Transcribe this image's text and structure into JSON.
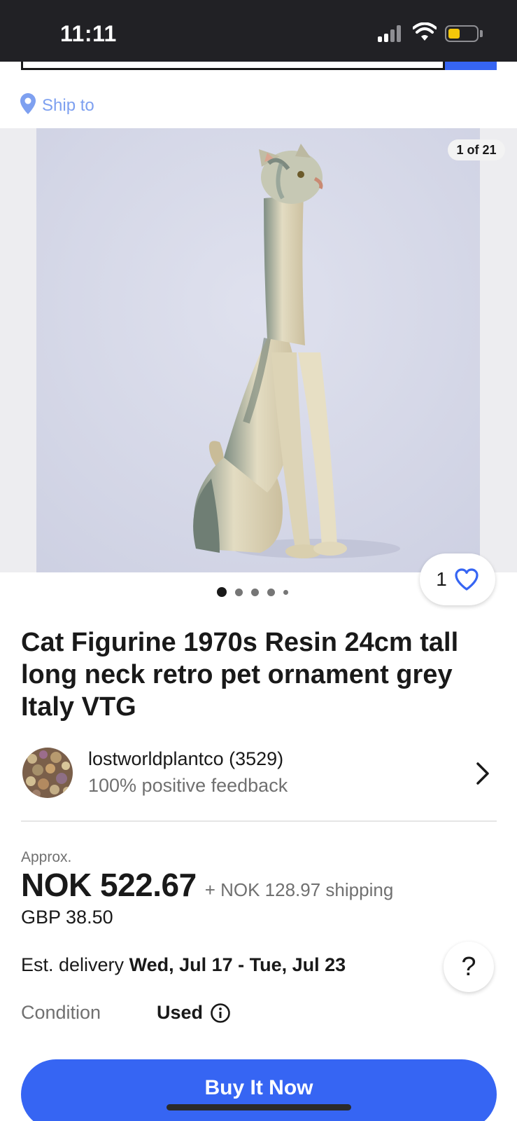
{
  "status_bar": {
    "time": "11:11"
  },
  "ship_to": {
    "label": "Ship to"
  },
  "gallery": {
    "counter": "1 of 21",
    "watch_count": "1",
    "dots_total": 5,
    "dots_active_index": 0
  },
  "listing": {
    "title": "Cat Figurine 1970s Resin 24cm tall long neck retro pet ornament grey Italy VTG"
  },
  "seller": {
    "name": "lostworldplantco (3529)",
    "feedback": "100% positive feedback"
  },
  "price": {
    "approx_label": "Approx.",
    "amount": "NOK 522.67",
    "shipping": "+ NOK 128.97 shipping",
    "original": "GBP 38.50"
  },
  "delivery": {
    "label": "Est. delivery",
    "dates": "Wed, Jul 17 - Tue, Jul 23"
  },
  "condition": {
    "label": "Condition",
    "value": "Used"
  },
  "help": {
    "symbol": "?"
  },
  "actions": {
    "buy_now": "Buy It Now"
  },
  "colors": {
    "accent": "#3665f3",
    "status_bar": "#212125",
    "ship_to_link": "#7ea0f0",
    "secondary_text": "#707070"
  }
}
